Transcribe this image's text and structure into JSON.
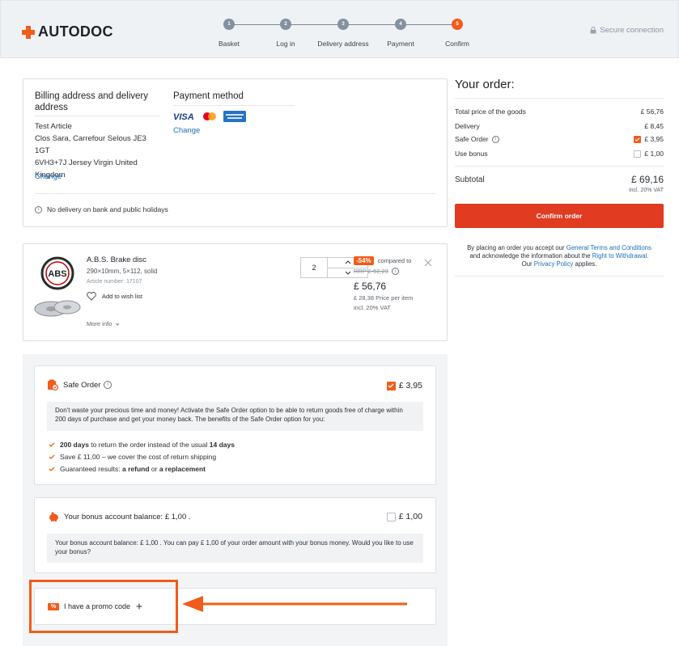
{
  "header": {
    "logo": "AUTODOC",
    "secure": "Secure connection",
    "steps": [
      {
        "num": "1",
        "label": "Basket"
      },
      {
        "num": "2",
        "label": "Log in"
      },
      {
        "num": "3",
        "label": "Delivery address"
      },
      {
        "num": "4",
        "label": "Payment"
      },
      {
        "num": "5",
        "label": "Confirm"
      }
    ],
    "active_step": 5
  },
  "billing": {
    "title_line1": "Billing address and delivery",
    "title_line2": "address",
    "name": "Test Article",
    "address_line1": "Clos Sara, Carrefour Selous JE3",
    "address_line2": "1GT",
    "address_line3": "6VH3+7J Jersey Virgin United Kingdom",
    "change": "Change",
    "payment_title": "Payment method",
    "payment_logos": [
      "VISA",
      "Mastercard",
      "American Express"
    ],
    "payment_change": "Change",
    "notice": "No delivery on bank and public holidays"
  },
  "product": {
    "name": "A.B.S. Brake disc",
    "specs": "290×10mm, 5×112, solid",
    "article": "Article number: 17107",
    "wishlist": "Add to wish list",
    "more_info": "More info",
    "brand": "ABS",
    "quantity": "2",
    "discount": "-54%",
    "compared_to": "compared to",
    "rrp": "RRP £ 62,23",
    "price": "£ 56,76",
    "per_item": "£ 28,38 Price per item",
    "vat": "incl. 20% VAT"
  },
  "safe_order": {
    "title": "Safe Order",
    "price": "£ 3,95",
    "description": "Don't waste your precious time and money! Activate the Safe Order option to be able to return goods free of charge within 200 days of purchase and get your money back. The benefits of the Safe Order option for you:",
    "benefit1_bold": "200 days",
    "benefit1_rest": " to return the order instead of the usual ",
    "benefit1_bold2": "14 days",
    "benefit2": "Save £ 11,00 – we cover the cost of return shipping",
    "benefit3_start": "Guaranteed results: ",
    "benefit3_bold1": "a refund",
    "benefit3_mid": " or ",
    "benefit3_bold2": "a replacement"
  },
  "bonus": {
    "title": "Your bonus account balance: £ 1,00 .",
    "price": "£ 1,00",
    "description": "Your bonus account balance: £ 1,00 . You can pay £ 1,00 of your order amount with your bonus money. Would you like to use your bonus?"
  },
  "promo": {
    "label": "I have a promo code",
    "icon_text": "%"
  },
  "order": {
    "title": "Your order:",
    "rows": [
      {
        "label": "Total price of the goods",
        "value": "£ 56,76"
      },
      {
        "label": "Delivery",
        "value": "£ 8,45"
      },
      {
        "label": "Safe Order",
        "value": "£ 3,95"
      },
      {
        "label": "Use bonus",
        "value": "£ 1,00"
      }
    ],
    "subtotal_label": "Subtotal",
    "subtotal_value": "£ 69,16",
    "vat": "incl. 20% VAT",
    "confirm": "Confirm order",
    "legal1": "By placing an order you accept our ",
    "legal_link1": "General Terms and Conditions",
    "legal2": "and acknowledge the information about the ",
    "legal_link2": "Right to Withdrawal",
    "legal3": "Our ",
    "legal_link3": "Privacy Policy",
    "legal4": " applies."
  },
  "colors": {
    "accent": "#f05c1a",
    "confirm": "#e13b22",
    "link": "#1f6fb3"
  }
}
